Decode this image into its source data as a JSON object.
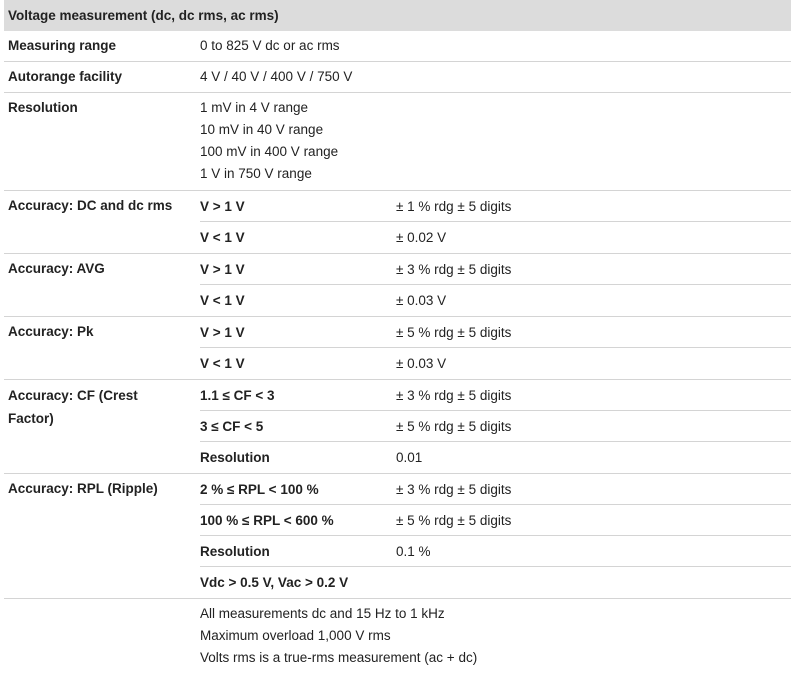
{
  "header": {
    "title": "Voltage measurement (dc, dc rms, ac rms)"
  },
  "rows": {
    "measuring_range": {
      "label": "Measuring range",
      "value": "0 to 825 V dc or ac rms"
    },
    "autorange": {
      "label": "Autorange facility",
      "value": "4 V / 40 V / 400 V / 750 V"
    },
    "resolution": {
      "label": "Resolution",
      "lines": [
        "1 mV in 4 V range",
        "10 mV in 40 V range",
        "100 mV in 400 V range",
        "1 V in 750 V range"
      ]
    },
    "acc_dc": {
      "label": "Accuracy: DC and dc rms",
      "subs": [
        {
          "cond": "V > 1 V",
          "val": "± 1 % rdg ± 5 digits"
        },
        {
          "cond": "V < 1 V",
          "val": "± 0.02 V"
        }
      ]
    },
    "acc_avg": {
      "label": "Accuracy: AVG",
      "subs": [
        {
          "cond": "V > 1 V",
          "val": "± 3 % rdg ± 5 digits"
        },
        {
          "cond": "V < 1 V",
          "val": "± 0.03 V"
        }
      ]
    },
    "acc_pk": {
      "label": "Accuracy: Pk",
      "subs": [
        {
          "cond": "V > 1 V",
          "val": "± 5 % rdg ± 5 digits"
        },
        {
          "cond": "V < 1 V",
          "val": "± 0.03 V"
        }
      ]
    },
    "acc_cf": {
      "label_line1": "Accuracy: CF (Crest",
      "label_line2": "Factor)",
      "subs": [
        {
          "cond": "1.1 ≤ CF < 3",
          "val": "± 3 % rdg ± 5 digits"
        },
        {
          "cond": "3 ≤ CF < 5",
          "val": "± 5 % rdg ± 5 digits"
        },
        {
          "cond": "Resolution",
          "val": "0.01"
        }
      ]
    },
    "acc_rpl": {
      "label": "Accuracy: RPL (Ripple)",
      "subs": [
        {
          "cond": "2 % ≤ RPL < 100 %",
          "val": "± 3 % rdg ± 5 digits"
        },
        {
          "cond": "100 % ≤ RPL < 600 %",
          "val": "± 5 % rdg ± 5 digits"
        },
        {
          "cond": "Resolution",
          "val": "0.1 %"
        },
        {
          "cond": "Vdc > 0.5 V, Vac > 0.2 V",
          "val": ""
        }
      ]
    },
    "notes": {
      "lines": [
        "All measurements dc and 15 Hz to 1 kHz",
        "Maximum overload 1,000 V rms",
        "Volts rms is a true-rms measurement (ac + dc)"
      ]
    }
  }
}
